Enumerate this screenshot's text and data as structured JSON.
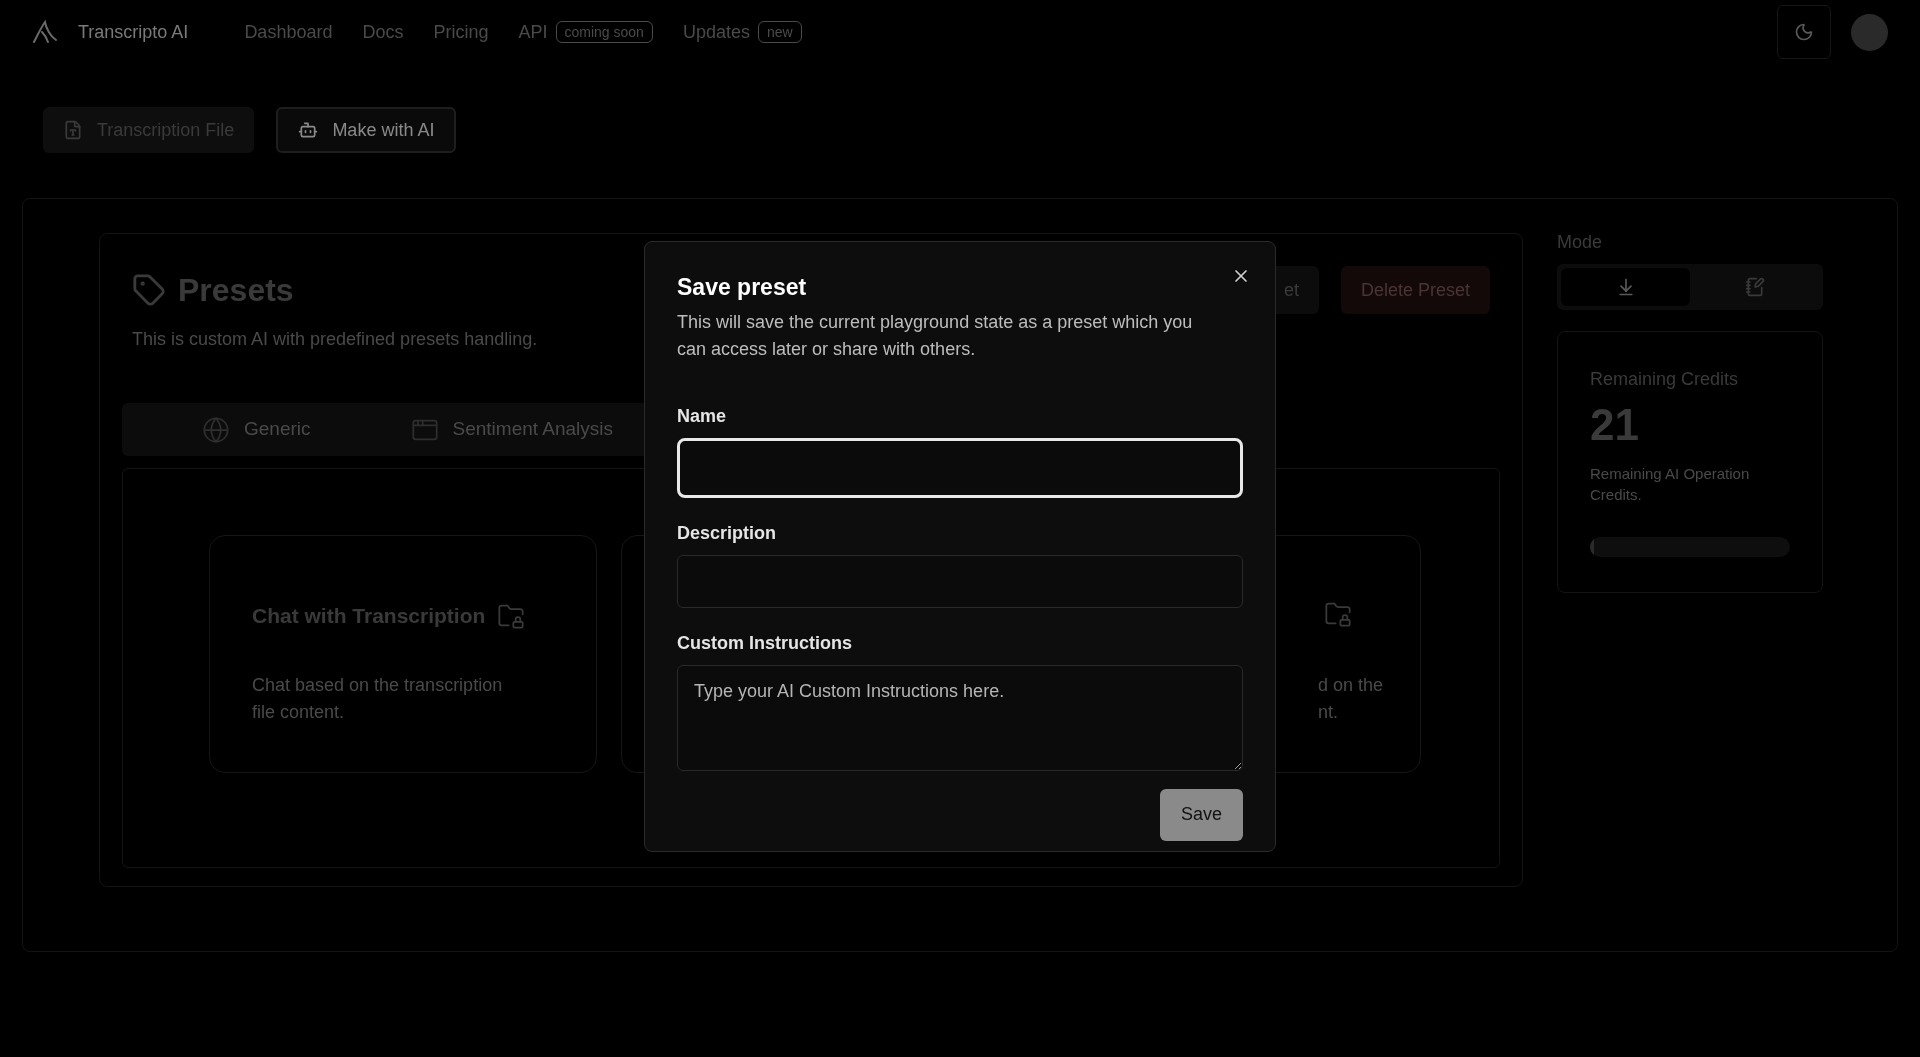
{
  "header": {
    "brand": "Transcripto AI",
    "nav": [
      {
        "label": "Dashboard"
      },
      {
        "label": "Docs"
      },
      {
        "label": "Pricing"
      },
      {
        "label": "API",
        "badge": "coming soon"
      },
      {
        "label": "Updates",
        "badge": "new"
      }
    ]
  },
  "source_tabs": [
    {
      "label": "Transcription File",
      "kind": "file",
      "selected": false
    },
    {
      "label": "Make with AI",
      "kind": "bot",
      "selected": true
    }
  ],
  "presets": {
    "title": "Presets",
    "subtitle": "This is custom AI with predefined presets handling.",
    "actions": [
      {
        "label": "et",
        "kind": "secondary"
      },
      {
        "label": "Delete Preset",
        "kind": "danger"
      }
    ],
    "tabs": [
      {
        "label": "Generic",
        "kind": "globe"
      },
      {
        "label": "Sentiment Analysis",
        "kind": "window"
      }
    ],
    "cards": [
      {
        "kind": "full",
        "title": "Chat with Transcription",
        "description": "Chat based on the transcription file content."
      },
      {
        "kind": "covered"
      },
      {
        "kind": "partial",
        "description_lines": [
          "d on the",
          "nt."
        ]
      }
    ]
  },
  "mode": {
    "label": "Mode",
    "options": [
      {
        "kind": "download",
        "selected": true
      },
      {
        "kind": "notes",
        "selected": false
      }
    ]
  },
  "credits": {
    "title": "Remaining Credits",
    "value": "21",
    "caption": "Remaining AI Operation Credits.",
    "level": 0.02
  },
  "dialog": {
    "title": "Save preset",
    "description": "This will save the current playground state as a preset which you can access later or share with others.",
    "fields": [
      {
        "label": "Name",
        "kind": "input",
        "focused": true
      },
      {
        "label": "Description",
        "kind": "input",
        "focused": false
      },
      {
        "label": "Custom Instructions",
        "kind": "textarea",
        "placeholder": "Type your AI Custom Instructions here.",
        "focused": false
      }
    ],
    "submit": "Save"
  }
}
